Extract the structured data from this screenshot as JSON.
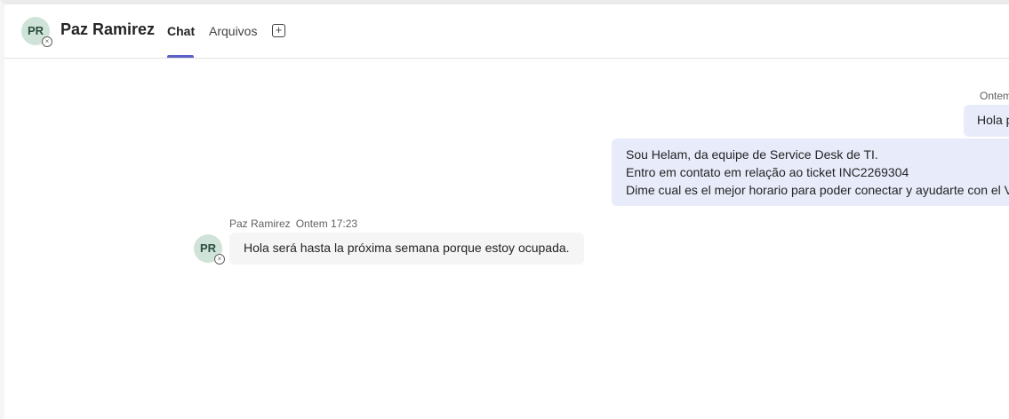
{
  "header": {
    "avatar_initials": "PR",
    "contact_name": "Paz Ramirez",
    "tabs": [
      {
        "label": "Chat",
        "active": true
      },
      {
        "label": "Arquivos",
        "active": false
      }
    ],
    "add_tab_icon": "plus-square-icon",
    "presence_icon": "offline-x-icon",
    "accent_color": "#5b5fc7"
  },
  "messages": {
    "sent": {
      "timestamp": "Ontem",
      "bubble1": "Hola p",
      "bubble2_lines": [
        "Sou Helam, da equipe de Service Desk de TI.",
        "Entro em contato em relação ao ticket INC2269304",
        "Dime cual es el mejor horario para poder conectar y ayudarte con el V"
      ]
    },
    "received": {
      "sender": "Paz Ramirez",
      "timestamp": "Ontem 17:23",
      "avatar_initials": "PR",
      "text": "Hola será hasta la próxima semana porque estoy ocupada."
    }
  }
}
